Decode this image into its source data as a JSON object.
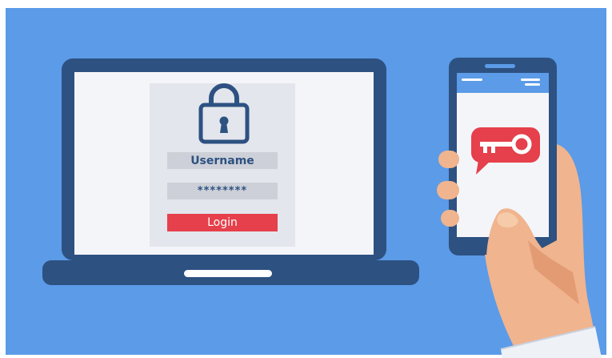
{
  "login_form": {
    "username_label": "Username",
    "password_value": "********",
    "login_button_label": "Login"
  },
  "icons": {
    "lock": "padlock-icon",
    "key_message": "key-in-speech-bubble-icon",
    "hand": "hand-holding-phone"
  },
  "colors": {
    "background": "#5b9be8",
    "device_frame": "#2d5181",
    "screen": "#f4f5f9",
    "form_panel": "#e4e6ed",
    "field": "#cdd0d8",
    "field_text": "#2d5181",
    "login_button": "#e5404b",
    "login_text": "#ffffff",
    "phone_bar": "#5b9be8",
    "key_bubble": "#e5404b",
    "skin": "#f0b48e",
    "skin_shadow": "#e39b74",
    "sleeve": "#eef1f6"
  }
}
